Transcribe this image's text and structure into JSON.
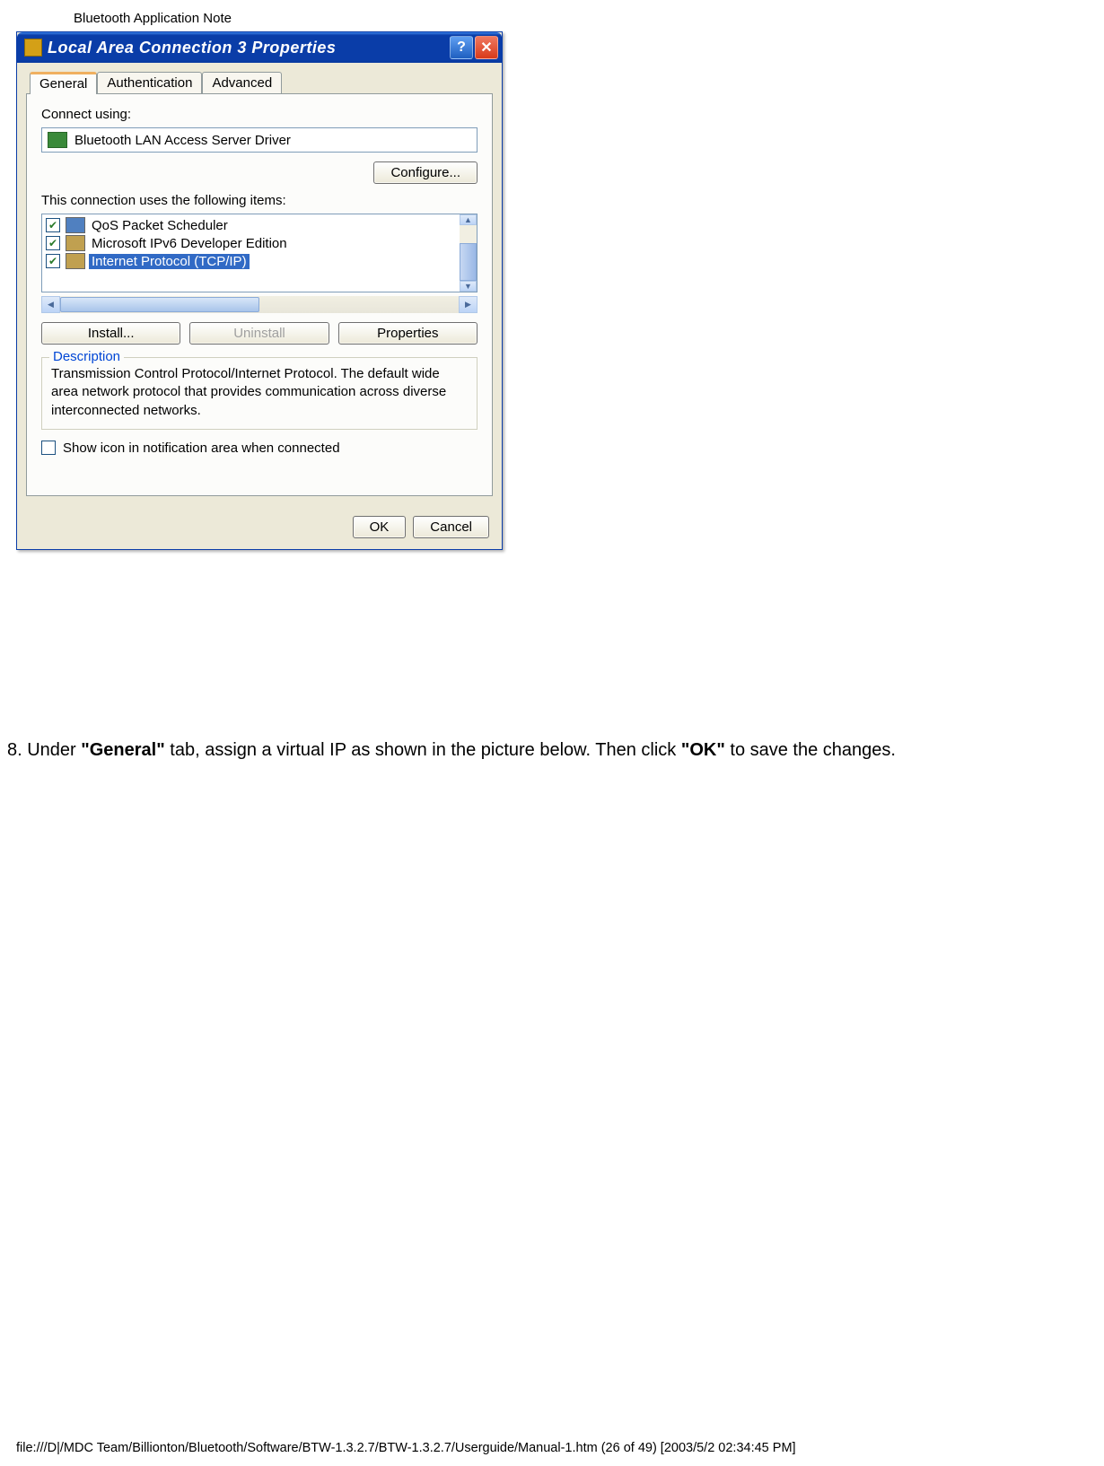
{
  "page_header": "Bluetooth Application Note",
  "dialog": {
    "title": "Local Area Connection 3 Properties",
    "tabs": [
      "General",
      "Authentication",
      "Advanced"
    ],
    "active_tab": 0,
    "connect_using_label": "Connect using:",
    "adapter_name": "Bluetooth LAN Access Server Driver",
    "configure_btn": "Configure...",
    "items_label": "This connection uses the following items:",
    "items": [
      {
        "checked": true,
        "label": "QoS Packet Scheduler",
        "selected": false
      },
      {
        "checked": true,
        "label": "Microsoft IPv6 Developer Edition",
        "selected": false
      },
      {
        "checked": true,
        "label": "Internet Protocol (TCP/IP)",
        "selected": true
      }
    ],
    "install_btn": "Install...",
    "uninstall_btn": "Uninstall",
    "properties_btn": "Properties",
    "description_legend": "Description",
    "description_text": "Transmission Control Protocol/Internet Protocol. The default wide area network protocol that provides communication across diverse interconnected networks.",
    "show_icon_label": "Show icon in notification area when connected",
    "show_icon_checked": false,
    "ok_btn": "OK",
    "cancel_btn": "Cancel"
  },
  "instruction": {
    "prefix": "8. Under ",
    "bold1": "\"General\"",
    "mid": " tab, assign a virtual IP as shown in the picture below. Then click ",
    "bold2": "\"OK\"",
    "suffix": " to save the changes."
  },
  "footer": "file:///D|/MDC Team/Billionton/Bluetooth/Software/BTW-1.3.2.7/BTW-1.3.2.7/Userguide/Manual-1.htm (26 of 49) [2003/5/2 02:34:45 PM]"
}
